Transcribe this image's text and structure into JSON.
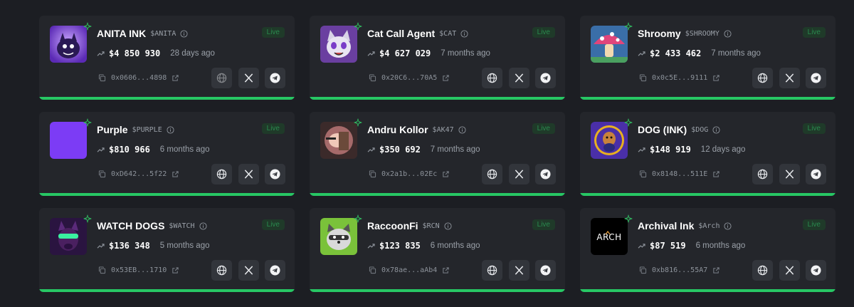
{
  "status_label": "Live",
  "colors": {
    "accent": "#27c764",
    "card_bg": "#24262b",
    "page_bg": "#1c1e23"
  },
  "tokens": [
    {
      "name": "ANITA INK",
      "ticker": "$ANITA",
      "market_cap": "$4 850 930",
      "age": "28 days ago",
      "address": "0x0606...4898",
      "avatar": "purple-monster-avatar",
      "website_dimmed": true
    },
    {
      "name": "Cat Call Agent",
      "ticker": "$CAT",
      "market_cap": "$4 627 029",
      "age": "7 months ago",
      "address": "0x20C6...70A5",
      "avatar": "cat-avatar",
      "website_dimmed": false
    },
    {
      "name": "Shroomy",
      "ticker": "$SHROOMY",
      "market_cap": "$2 433 462",
      "age": "7 months ago",
      "address": "0x0c5E...9111",
      "avatar": "mushroom-avatar",
      "website_dimmed": false
    },
    {
      "name": "Purple",
      "ticker": "$PURPLE",
      "market_cap": "$810 966",
      "age": "6 months ago",
      "address": "0xD642...5f22",
      "avatar": "purple-square-avatar",
      "website_dimmed": false
    },
    {
      "name": "Andru Kollor",
      "ticker": "$AK47",
      "market_cap": "$350 692",
      "age": "7 months ago",
      "address": "0x2a1b...02Ec",
      "avatar": "character-avatar",
      "website_dimmed": false
    },
    {
      "name": "DOG (INK)",
      "ticker": "$DOG",
      "market_cap": "$148 919",
      "age": "12 days ago",
      "address": "0x8148...511E",
      "avatar": "dog-avatar",
      "website_dimmed": false
    },
    {
      "name": "WATCH DOGS",
      "ticker": "$WATCH",
      "market_cap": "$136 348",
      "age": "5 months ago",
      "address": "0x53EB...1710",
      "avatar": "dog-goggles-avatar",
      "website_dimmed": false
    },
    {
      "name": "RaccoonFi",
      "ticker": "$RCN",
      "market_cap": "$123 835",
      "age": "6 months ago",
      "address": "0x78ae...aAb4",
      "avatar": "raccoon-avatar",
      "website_dimmed": false
    },
    {
      "name": "Archival Ink",
      "ticker": "$Arch",
      "market_cap": "$87 519",
      "age": "6 months ago",
      "address": "0xb816...55A7",
      "avatar": "arch-logo-avatar",
      "website_dimmed": false
    }
  ]
}
